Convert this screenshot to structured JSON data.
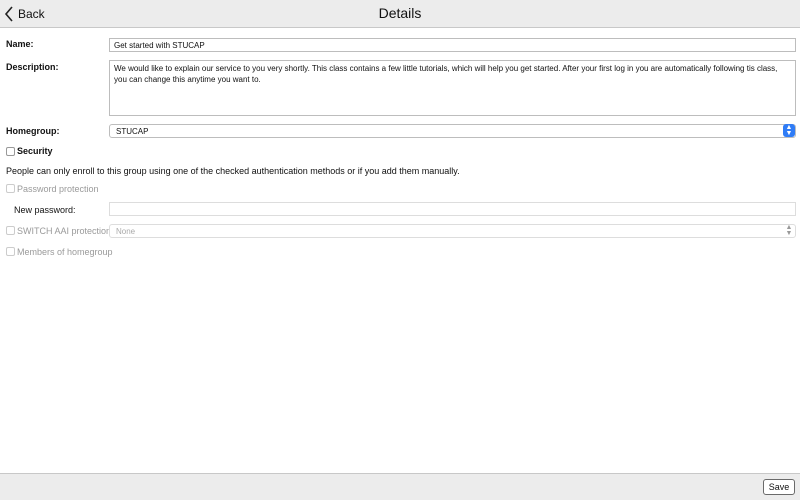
{
  "header": {
    "back_label": "Back",
    "title": "Details"
  },
  "form": {
    "name_label": "Name:",
    "name_value": "Get started with STUCAP",
    "description_label": "Description:",
    "description_value": "We would like to explain our service to you very shortly. This class contains a few little tutorials, which will help you get started. After your first log in you are automatically following tis class, you can change this anytime you want to.",
    "homegroup_label": "Homegroup:",
    "homegroup_value": "STUCAP",
    "security_label": "Security",
    "security_note": "People can only enroll to this group using one of the checked authentication methods or if you add them manually.",
    "password_protection_label": "Password protection",
    "new_password_label": "New password:",
    "new_password_value": "",
    "switch_aai_label": "SWITCH AAI protection",
    "switch_aai_value": "None",
    "members_homegroup_label": "Members of homegroup"
  },
  "footer": {
    "save_label": "Save"
  },
  "colors": {
    "accent": "#2f7cf6",
    "disabled_text": "#9a9a9a"
  }
}
